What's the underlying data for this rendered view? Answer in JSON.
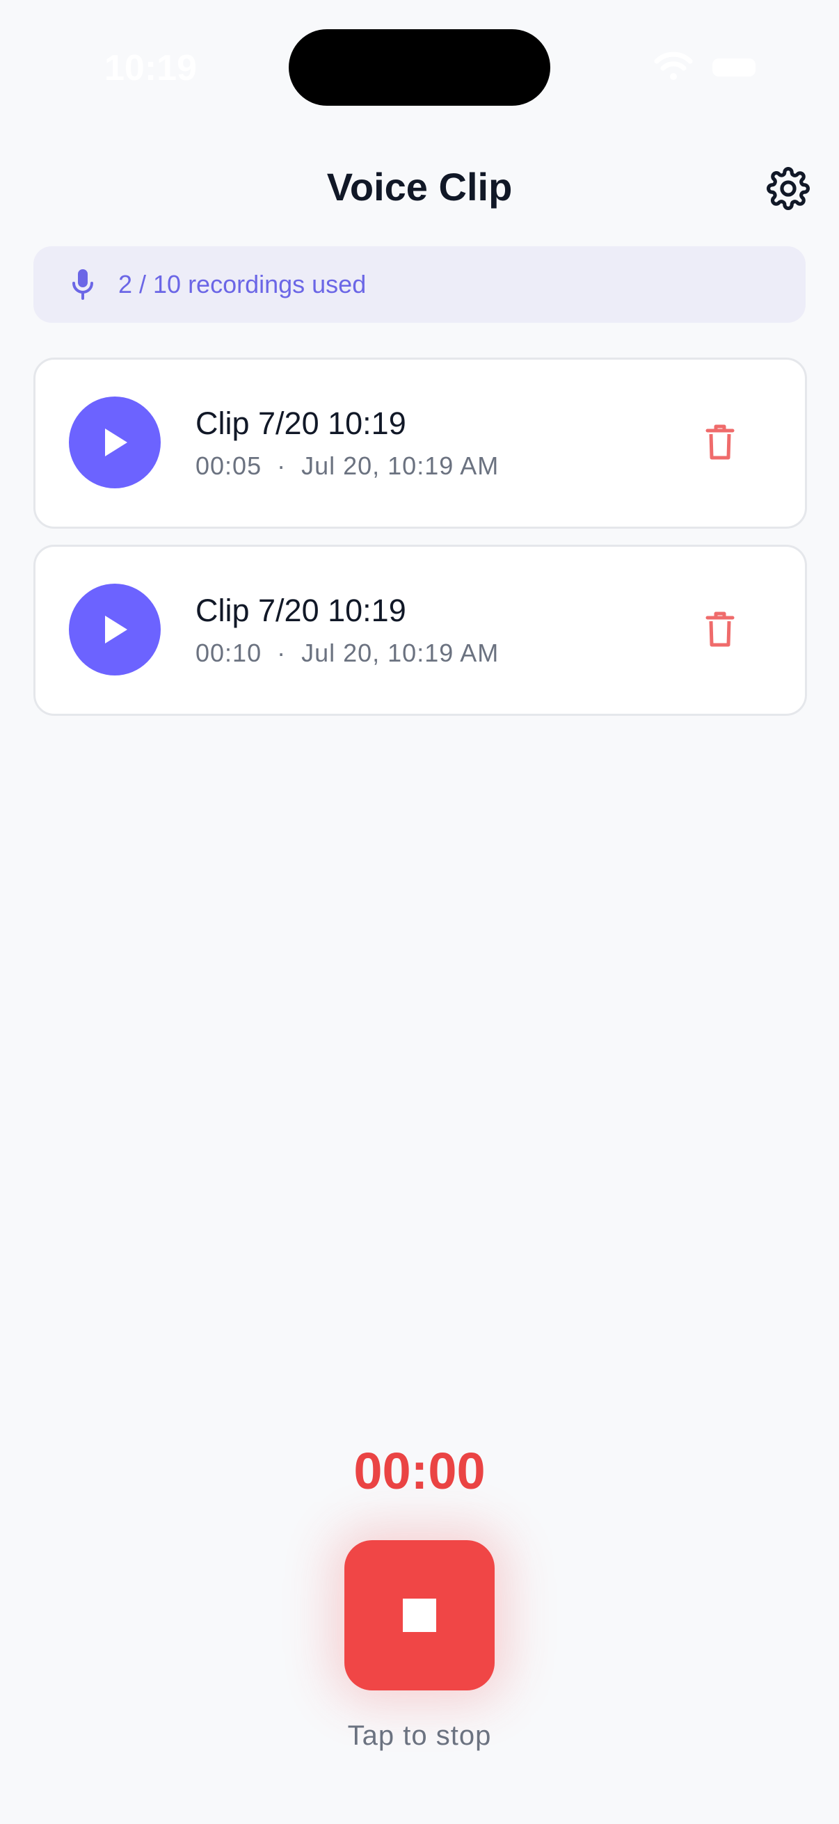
{
  "status_bar": {
    "time": "10:19"
  },
  "header": {
    "title": "Voice Clip"
  },
  "usage": {
    "text": "2 / 10 recordings used"
  },
  "clips": [
    {
      "title": "Clip 7/20 10:19",
      "duration": "00:05",
      "date": "Jul 20, 10:19 AM"
    },
    {
      "title": "Clip 7/20 10:19",
      "duration": "00:10",
      "date": "Jul 20, 10:19 AM"
    }
  ],
  "recorder": {
    "timer": "00:00",
    "hint": "Tap to stop"
  },
  "colors": {
    "accent": "#6c63ff",
    "record": "#f04646",
    "delete": "#ef6b6b",
    "banner_bg": "#ededf8"
  }
}
